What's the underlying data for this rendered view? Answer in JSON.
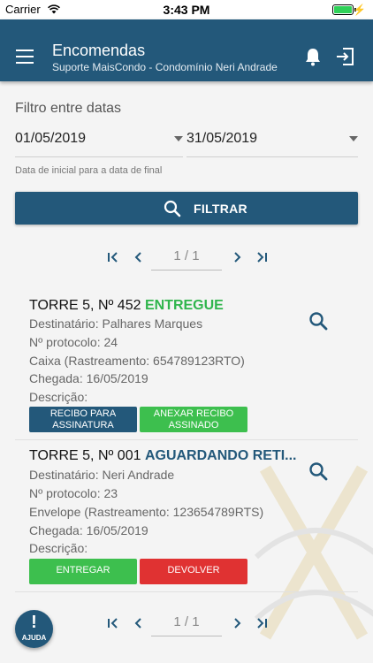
{
  "status_bar": {
    "carrier": "Carrier",
    "time": "3:43 PM"
  },
  "header": {
    "title": "Encomendas",
    "subtitle": "Suporte MaisCondo - Condomínio Neri Andrade",
    "icons": [
      "menu-icon",
      "bell-icon",
      "logout-icon"
    ]
  },
  "filter": {
    "title": "Filtro entre datas",
    "start_date": "01/05/2019",
    "end_date": "31/05/2019",
    "hint": "Data de inicial para a data de final",
    "button_label": "FILTRAR"
  },
  "pagination": {
    "label": "1 / 1",
    "current_page": 1,
    "total_pages": 1
  },
  "packages": [
    {
      "title": "TORRE 5, Nº 452",
      "status": "ENTREGUE",
      "recipient": "Destinatário: Palhares Marques",
      "protocol": "Nº protocolo: 24",
      "tracking": "Caixa (Rastreamento: 654789123RTO)",
      "arrival": "Chegada: 16/05/2019",
      "description": "Descrição:",
      "buttons": [
        "RECIBO PARA ASSINATURA",
        "ANEXAR RECIBO ASSINADO"
      ]
    },
    {
      "title": "TORRE 5, Nº 001",
      "status": "AGUARDANDO RETI...",
      "recipient": "Destinatário: Neri Andrade",
      "protocol": "Nº protocolo: 23",
      "tracking": "Envelope (Rastreamento: 123654789RTS)",
      "arrival": "Chegada: 16/05/2019",
      "description": "Descrição:",
      "buttons": [
        "ENTREGAR",
        "DEVOLVER"
      ]
    }
  ],
  "help": {
    "icon": "!",
    "label": "AJUDA"
  },
  "colors": {
    "primary": "#23587a",
    "success": "#3dbf4e",
    "status_delivered": "#2fb54c",
    "danger": "#e03232",
    "background": "#f4f4f4"
  }
}
